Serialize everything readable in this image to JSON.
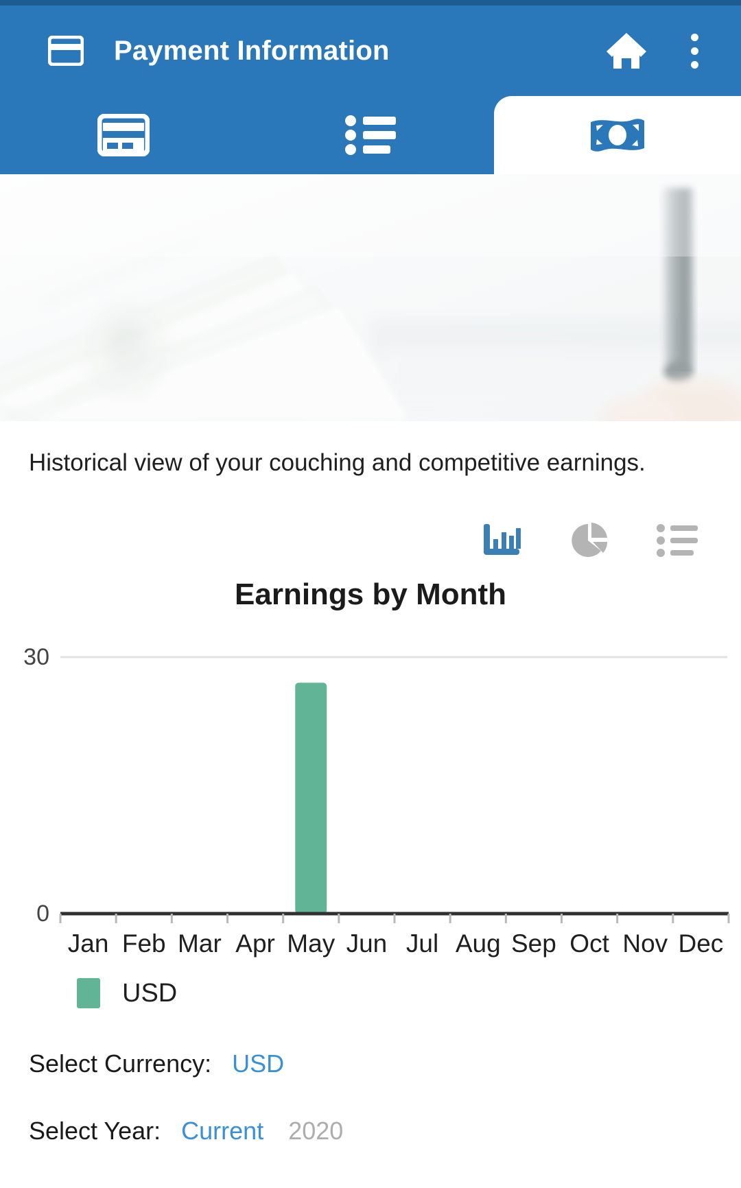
{
  "appbar": {
    "title": "Payment Information",
    "left_icon": "credit-card-icon",
    "home_icon": "home-icon",
    "overflow_icon": "more-vertical-icon"
  },
  "tabs": [
    {
      "id": "cards",
      "icon": "credit-card-icon",
      "active": false
    },
    {
      "id": "history",
      "icon": "list-icon",
      "active": false
    },
    {
      "id": "earnings",
      "icon": "money-bill-icon",
      "active": true
    }
  ],
  "hero": {
    "alt": "hands counting US dollar banknotes"
  },
  "main": {
    "description": "Historical view of your couching and competitive earnings.",
    "chart_toggles": [
      {
        "id": "bar",
        "icon": "bar-chart-icon",
        "active": true,
        "color": "#3b7fb5"
      },
      {
        "id": "pie",
        "icon": "pie-chart-icon",
        "active": false,
        "color": "#b4b4b4"
      },
      {
        "id": "list",
        "icon": "list-icon",
        "active": false,
        "color": "#b4b4b4"
      }
    ],
    "legend": [
      {
        "label": "USD",
        "color": "#62b496"
      }
    ]
  },
  "selectors": [
    {
      "id": "currency",
      "label": "Select Currency:",
      "options": [
        {
          "text": "USD",
          "state": "selected"
        }
      ]
    },
    {
      "id": "year",
      "label": "Select Year:",
      "options": [
        {
          "text": "Current",
          "state": "selected"
        },
        {
          "text": "2020",
          "state": "inactive"
        }
      ]
    }
  ],
  "chart_data": {
    "type": "bar",
    "title": "Earnings by Month",
    "xlabel": "",
    "ylabel": "",
    "categories": [
      "Jan",
      "Feb",
      "Mar",
      "Apr",
      "May",
      "Jun",
      "Jul",
      "Aug",
      "Sep",
      "Oct",
      "Nov",
      "Dec"
    ],
    "series": [
      {
        "name": "USD",
        "color": "#62b496",
        "values": [
          0,
          0,
          0,
          0,
          27,
          0,
          0,
          0,
          0,
          0,
          0,
          0
        ]
      }
    ],
    "ylim": [
      0,
      30
    ],
    "yticks": [
      0,
      30
    ],
    "ytick_labels": [
      "0",
      "30"
    ],
    "grid": true,
    "gridline_color": "#e3e3e3",
    "axis_color": "#303030",
    "legend_position": "bottom-left"
  }
}
